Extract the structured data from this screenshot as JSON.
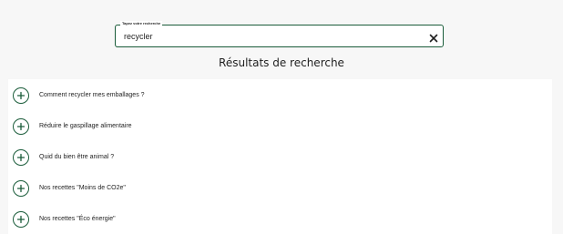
{
  "search": {
    "legend": "Tapez votre recherche",
    "value": "recycler",
    "clear_icon": "close-icon"
  },
  "results": {
    "title": "Résultats de recherche",
    "expand_icon": "plus-circle-icon",
    "items": [
      {
        "label": "Comment recycler mes emballages ?"
      },
      {
        "label": "Réduire le gaspillage alimentaire"
      },
      {
        "label": "Quid du bien être animal ?"
      },
      {
        "label": "Nos recettes \"Moins de CO2e\""
      },
      {
        "label": "Nos recettes \"Éco énergie\""
      }
    ]
  },
  "colors": {
    "accent": "#1a5c3a",
    "background": "#f7f7f7",
    "panel": "#ffffff",
    "text": "#1f1f1f"
  }
}
